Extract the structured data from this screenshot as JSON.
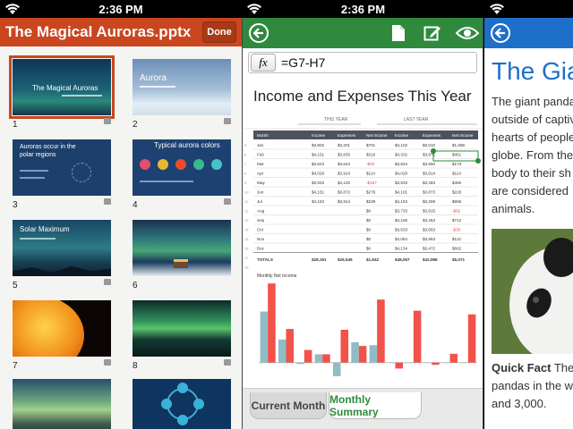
{
  "status": {
    "time": "2:36 PM"
  },
  "presentation": {
    "title": "The Magical Auroras.pptx",
    "done_label": "Done",
    "slides": [
      {
        "num": "1",
        "title": "The Magical Auroras",
        "bg": "#1b4f74"
      },
      {
        "num": "2",
        "title": "Aurora",
        "bg": "#7da2c5"
      },
      {
        "num": "3",
        "title": "Auroras occur in the polar regions",
        "bg": "#1d3f6c"
      },
      {
        "num": "4",
        "title": "Typical aurora colors",
        "bg": "#1d4271"
      },
      {
        "num": "5",
        "title": "Solar Maximum",
        "bg": "#1d5470"
      },
      {
        "num": "6",
        "title": "",
        "bg": "#1a3b5c"
      },
      {
        "num": "7",
        "title": "",
        "bg": "#d24a10"
      },
      {
        "num": "8",
        "title": "",
        "bg": "#0f3b3b"
      },
      {
        "num": "",
        "title": "",
        "bg": "#5d8a5f"
      },
      {
        "num": "",
        "title": "",
        "bg": "#0d3560"
      }
    ]
  },
  "spreadsheet": {
    "formula_fx": "fx",
    "formula": "=G7-H7",
    "title": "Income and Expenses This Year",
    "this_year": "THIS YEAR",
    "last_year": "LAST YEAR",
    "headers": [
      "Month",
      "Income",
      "Expenses",
      "Net Income",
      "Income",
      "Expenses",
      "Net Income"
    ],
    "rows": [
      [
        "Jan",
        "$3,902",
        "$3,201",
        "$701",
        "$4,102",
        "$3,010",
        "$1,086"
      ],
      [
        "Feb",
        "$4,151",
        "$3,835",
        "$316",
        "$4,332",
        "$3,871",
        "$461"
      ],
      [
        "Mar",
        "$3,623",
        "$3,643",
        "-$20",
        "$3,823",
        "$3,650",
        "$173"
      ],
      [
        "Apr",
        "$4,028",
        "$3,914",
        "$114",
        "$4,028",
        "$3,914",
        "$114"
      ],
      [
        "May",
        "$3,933",
        "$4,120",
        "-$187",
        "$3,933",
        "$3,483",
        "$450"
      ],
      [
        "Jun",
        "$4,151",
        "$3,872",
        "$279",
        "$4,101",
        "$3,873",
        "$228"
      ],
      [
        "Jul",
        "$4,153",
        "$3,914",
        "$239",
        "$4,153",
        "$3,288",
        "$865"
      ],
      [
        "Aug",
        "",
        "",
        "$0",
        "$3,733",
        "$3,815",
        "-$82"
      ],
      [
        "Sep",
        "",
        "",
        "$0",
        "$4,165",
        "$3,453",
        "$712"
      ],
      [
        "Oct",
        "",
        "",
        "$0",
        "$3,633",
        "$3,663",
        "-$30"
      ],
      [
        "Nov",
        "",
        "",
        "$0",
        "$4,084",
        "$3,963",
        "$121"
      ],
      [
        "Dec",
        "",
        "",
        "$0",
        "$4,134",
        "$3,472",
        "$662"
      ]
    ],
    "totals": [
      "TOTALS",
      "$28,191",
      "$26,549",
      "$1,642",
      "$48,057",
      "$42,986",
      "$5,071"
    ],
    "row_numbers": [
      "5",
      "6",
      "7",
      "8",
      "9",
      "10",
      "11",
      "12",
      "13",
      "14",
      "15",
      "16",
      "17",
      "18"
    ],
    "chart_label": "Monthly Net Income",
    "tab_current": "Current Month",
    "tab_monthly": "Monthly Summary"
  },
  "chart_data": {
    "type": "bar",
    "title": "Monthly Net Income",
    "categories": [
      "Jan",
      "Feb",
      "Mar",
      "Apr",
      "May",
      "Jun",
      "Jul",
      "Aug",
      "Sep",
      "Oct",
      "Nov",
      "Dec"
    ],
    "series": [
      {
        "values": [
          701,
          316,
          -20,
          114,
          -187,
          279,
          239,
          0,
          0,
          0,
          0,
          0
        ]
      },
      {
        "values": [
          1086,
          461,
          173,
          114,
          450,
          228,
          865,
          -82,
          712,
          -30,
          121,
          662
        ]
      }
    ],
    "colors": [
      "#8fbcc5",
      "#f2524a"
    ],
    "ylim": [
      -200,
      1100
    ]
  },
  "document": {
    "heading": "The Gia",
    "lines": [
      "The giant pandas",
      "outside of captiv",
      "hearts of people",
      "globe. From the",
      "body to their sh",
      "are considered",
      "animals."
    ],
    "fact_bold": "Quick Fact",
    "fact_rest": " The",
    "fact_lines": [
      "pandas in the w",
      "and 3,000."
    ]
  },
  "colors": {
    "ppt_orange": "#c9461f",
    "excel_green": "#2f8a3d",
    "word_blue": "#1e6fc9"
  }
}
